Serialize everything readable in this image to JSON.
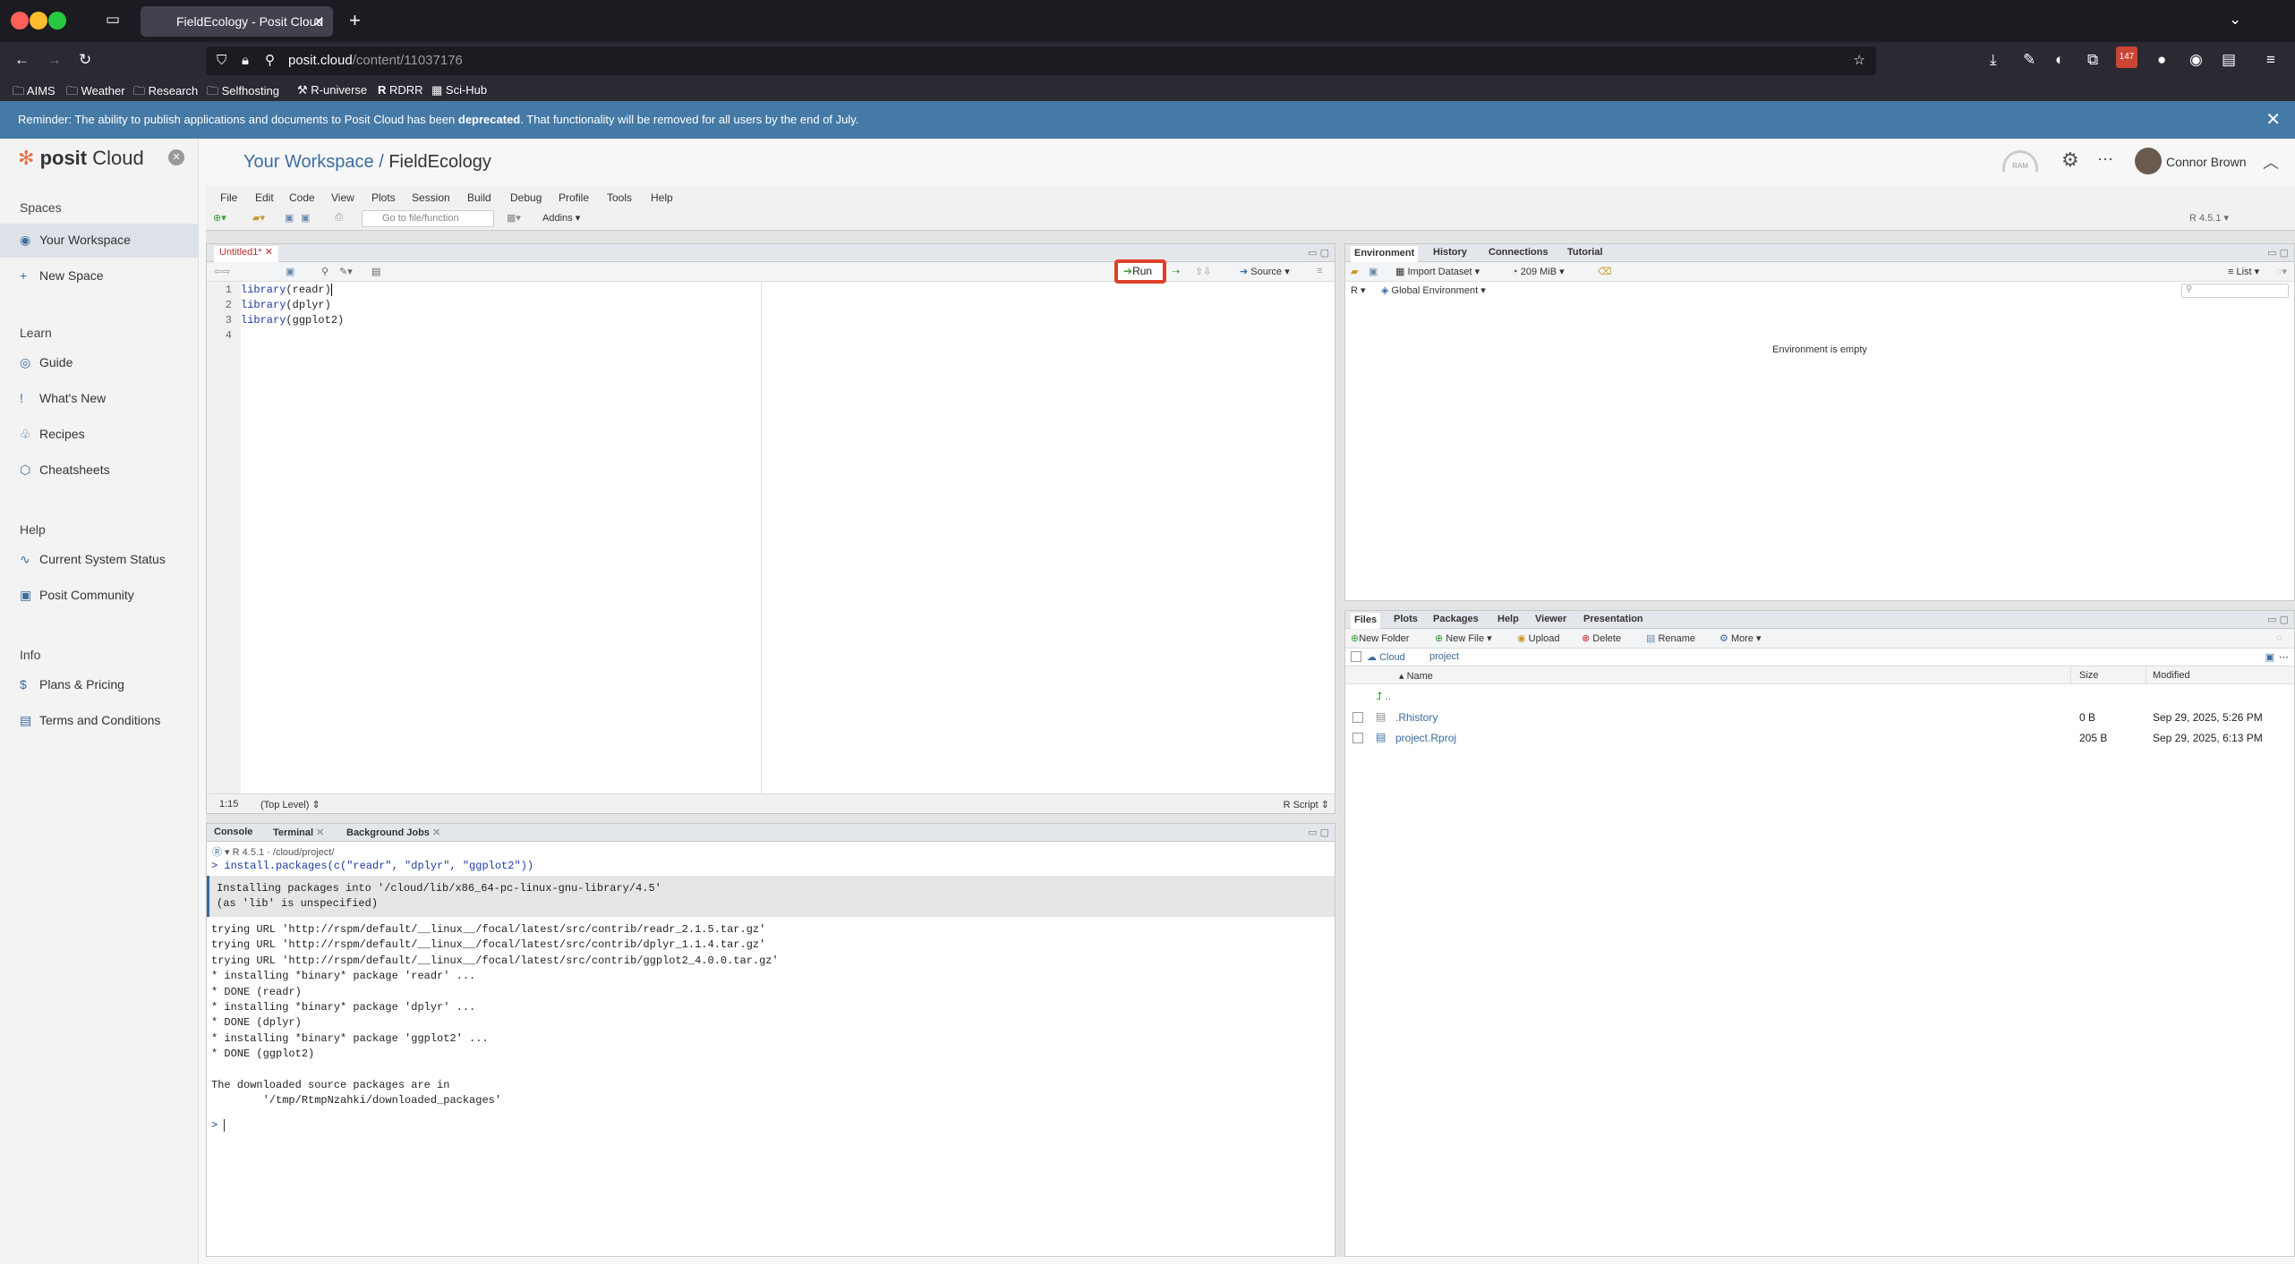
{
  "browser": {
    "tab_title": "FieldEcology - Posit Cloud",
    "url_host": "posit.cloud",
    "url_path": "/content/11037176",
    "badge": "147",
    "bookmarks": [
      "AIMS",
      "Weather",
      "Research",
      "Selfhosting",
      "R-universe",
      "RDRR",
      "Sci-Hub"
    ]
  },
  "banner": {
    "text_before": "Reminder: The ability to publish applications and documents to Posit Cloud has been ",
    "text_bold": "deprecated",
    "text_after": ". That functionality will be removed for all users by the end of July."
  },
  "sidebar": {
    "logo": "posit",
    "logo2": "Cloud",
    "spaces_header": "Spaces",
    "your_workspace": "Your Workspace",
    "new_space": "New Space",
    "learn_header": "Learn",
    "guide": "Guide",
    "whats_new": "What's New",
    "recipes": "Recipes",
    "cheatsheets": "Cheatsheets",
    "help_header": "Help",
    "system_status": "Current System Status",
    "community": "Posit Community",
    "info_header": "Info",
    "pricing": "Plans & Pricing",
    "terms": "Terms and Conditions"
  },
  "header": {
    "workspace": "Your Workspace",
    "sep": "/",
    "project": "FieldEcology",
    "ram": "RAM",
    "user": "Connor Brown"
  },
  "rstudio": {
    "menu": [
      "File",
      "Edit",
      "Code",
      "View",
      "Plots",
      "Session",
      "Build",
      "Debug",
      "Profile",
      "Tools",
      "Help"
    ],
    "goto_placeholder": "Go to file/function",
    "addins": "Addins",
    "r_version": "R 4.5.1",
    "editor": {
      "tab": "Untitled1*",
      "run": "Run",
      "source": "Source",
      "lines": [
        {
          "n": "1",
          "fn": "library",
          "arg": "readr"
        },
        {
          "n": "2",
          "fn": "library",
          "arg": "dplyr"
        },
        {
          "n": "3",
          "fn": "library",
          "arg": "ggplot2"
        },
        {
          "n": "4",
          "fn": "",
          "arg": ""
        }
      ],
      "status_pos": "1:15",
      "status_scope": "(Top Level)",
      "status_type": "R Script"
    },
    "console": {
      "tabs": [
        "Console",
        "Terminal",
        "Background Jobs"
      ],
      "path_label": "R 4.5.1",
      "path": "/cloud/project/",
      "command": "> install.packages(c(\"readr\", \"dplyr\", \"ggplot2\"))",
      "msg1": "Installing packages into '/cloud/lib/x86_64-pc-linux-gnu-library/4.5'",
      "msg2": "(as 'lib' is unspecified)",
      "out": [
        "trying URL 'http://rspm/default/__linux__/focal/latest/src/contrib/readr_2.1.5.tar.gz'",
        "trying URL 'http://rspm/default/__linux__/focal/latest/src/contrib/dplyr_1.1.4.tar.gz'",
        "trying URL 'http://rspm/default/__linux__/focal/latest/src/contrib/ggplot2_4.0.0.tar.gz'",
        "* installing *binary* package 'readr' ...",
        "* DONE (readr)",
        "* installing *binary* package 'dplyr' ...",
        "* DONE (dplyr)",
        "* installing *binary* package 'ggplot2' ...",
        "* DONE (ggplot2)",
        "",
        "The downloaded source packages are in",
        "        '/tmp/RtmpNzahki/downloaded_packages'"
      ],
      "prompt": ">"
    },
    "env": {
      "tabs": [
        "Environment",
        "History",
        "Connections",
        "Tutorial"
      ],
      "import": "Import Dataset",
      "mem": "209 MiB",
      "list": "List",
      "r_label": "R",
      "scope": "Global Environment",
      "empty": "Environment is empty"
    },
    "files": {
      "tabs": [
        "Files",
        "Plots",
        "Packages",
        "Help",
        "Viewer",
        "Presentation"
      ],
      "new_folder": "New Folder",
      "new_file": "New File",
      "upload": "Upload",
      "delete": "Delete",
      "rename": "Rename",
      "more": "More",
      "crumb1": "Cloud",
      "crumb2": "project",
      "cols": {
        "name": "Name",
        "size": "Size",
        "modified": "Modified"
      },
      "up": "..",
      "rows": [
        {
          "name": ".Rhistory",
          "size": "0 B",
          "modified": "Sep 29, 2025, 5:26 PM"
        },
        {
          "name": "project.Rproj",
          "size": "205 B",
          "modified": "Sep 29, 2025, 6:13 PM"
        }
      ]
    }
  }
}
